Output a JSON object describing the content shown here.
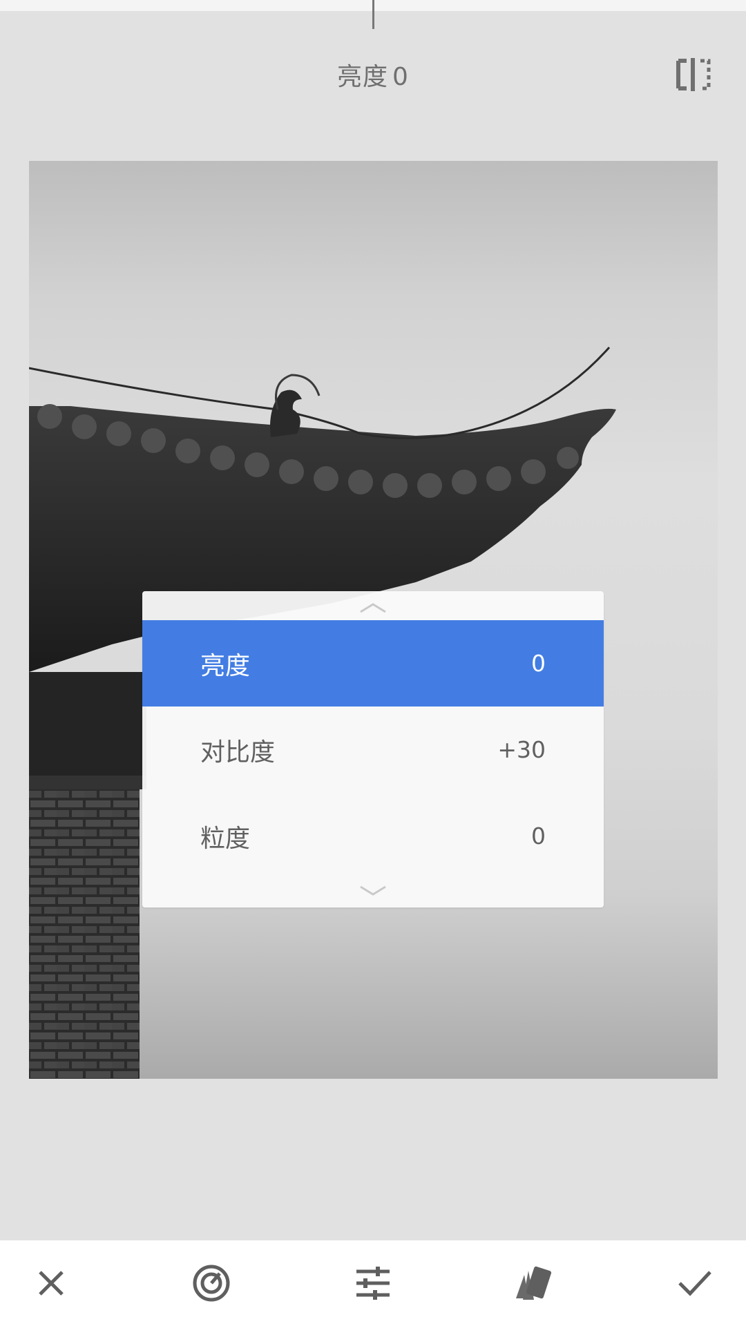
{
  "header": {
    "title": "亮度",
    "value": "0",
    "compare_icon": "compare-split-icon"
  },
  "menu": {
    "items": [
      {
        "label": "亮度",
        "value": "0",
        "selected": true
      },
      {
        "label": "对比度",
        "value": "+30",
        "selected": false
      },
      {
        "label": "粒度",
        "value": "0",
        "selected": false
      }
    ],
    "scroll_up_icon": "chevron-up-icon",
    "scroll_down_icon": "chevron-down-icon"
  },
  "bottom_bar": {
    "icons": [
      "close-icon",
      "auto-adjust-icon",
      "sliders-icon",
      "styles-icon",
      "check-icon"
    ]
  },
  "colors": {
    "selected": "#437de3",
    "background": "#e1e1e1",
    "icon": "#5f5f5f"
  }
}
